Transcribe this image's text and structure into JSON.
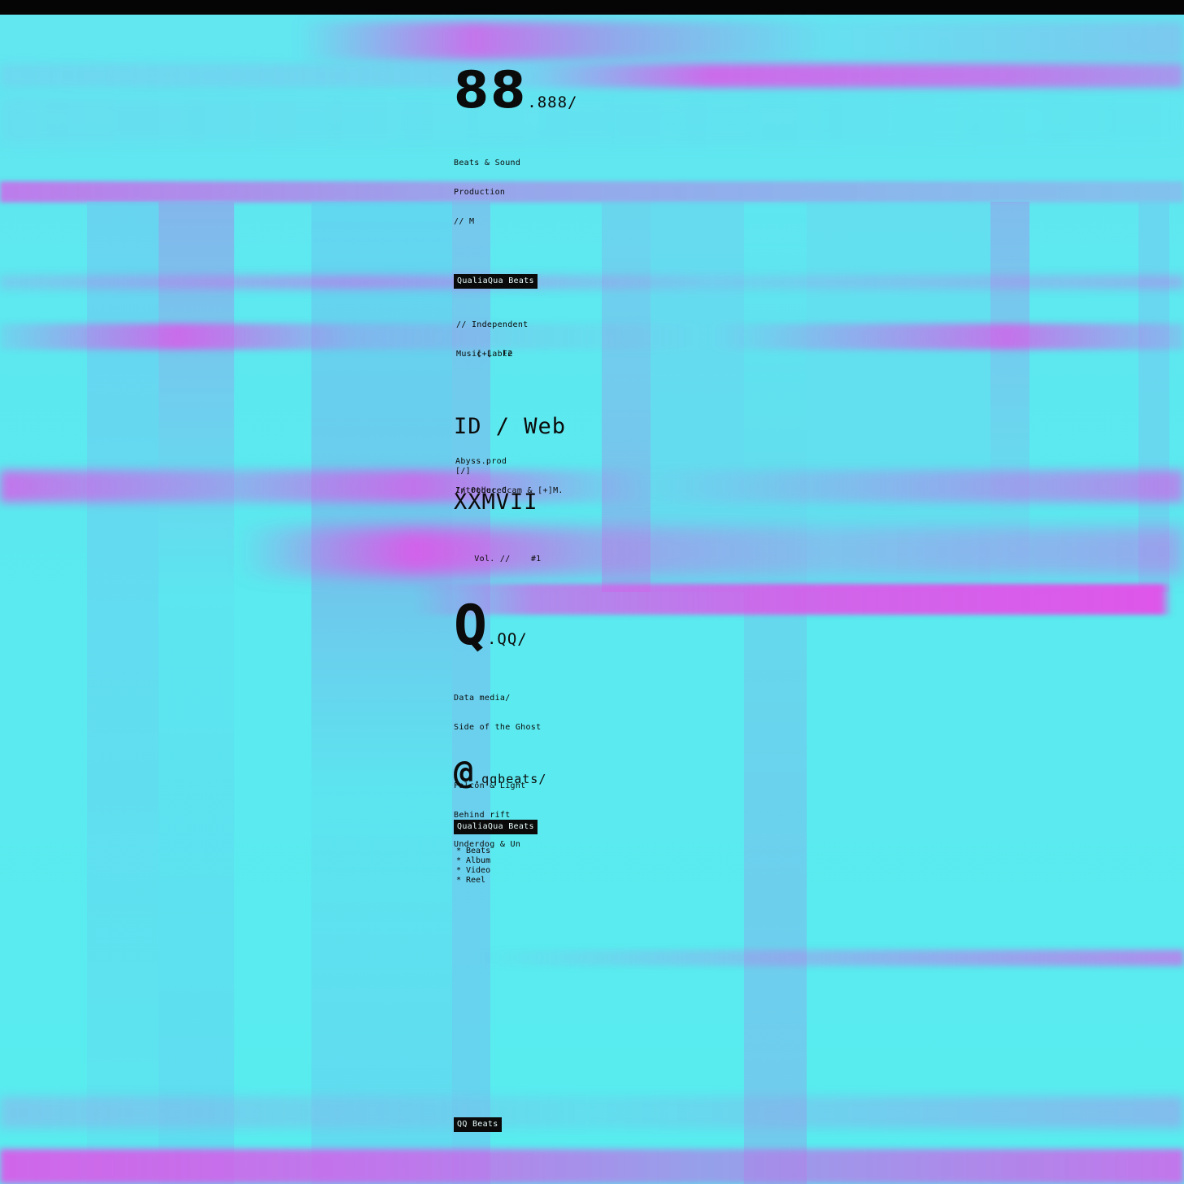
{
  "colors": {
    "background": "#59ebef",
    "accent": "#e54ee9",
    "ink": "#0b0b0b"
  },
  "hero": {
    "big": "88",
    "suffix": ".888/",
    "subtitle_line1": "Beats & Sound",
    "subtitle_line2": "Production"
  },
  "marker": "// M",
  "label_top": "QualiaQua Beats",
  "intro": {
    "line1": "// Independent",
    "line2": "Music Lable"
  },
  "toggle": {
    "bracket": "[+]",
    "label": "F2"
  },
  "headline": {
    "line1": "ID / Web",
    "line2": "XXMVII"
  },
  "credits": {
    "line1": "Abyss.prod",
    "line2": "Introduced"
  },
  "slash_link": "[/]",
  "other_link": "// Other Ccam & [+]M.",
  "volume": {
    "label": "Vol. //",
    "number": "#1"
  },
  "brand": {
    "big": "Q",
    "suffix": ".QQ/"
  },
  "description": {
    "line1": "Data media/",
    "line2": "Side of the Ghost",
    "line3": "Falcon & Light",
    "line4": "Behind rift",
    "line5": "Underdog & Un"
  },
  "handle": {
    "at": "@",
    "name": ".qqbeats/"
  },
  "label_mid": "QualiaQua Beats",
  "menu": [
    {
      "bullet": "*",
      "label": "Beats"
    },
    {
      "bullet": "*",
      "label": "Album"
    },
    {
      "bullet": "*",
      "label": "Video"
    },
    {
      "bullet": "*",
      "label": "Reel"
    }
  ],
  "footer_label": "QQ Beats"
}
